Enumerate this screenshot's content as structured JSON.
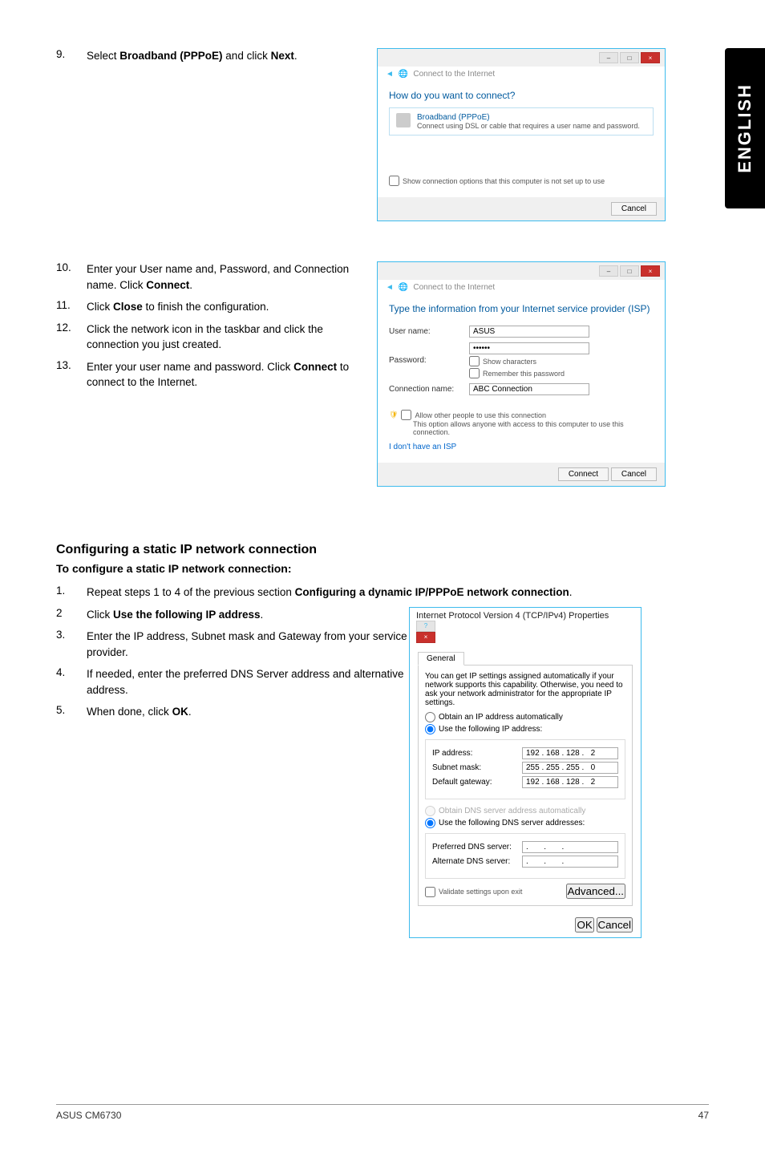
{
  "sideTab": "ENGLISH",
  "step9": {
    "num": "9.",
    "text_a": "Select ",
    "bold_a": "Broadband (PPPoE)",
    "text_b": " and click ",
    "bold_b": "Next",
    "text_c": "."
  },
  "dialog1": {
    "breadcrumb": "Connect to the Internet",
    "heading": "How do you want to connect?",
    "opt_title": "Broadband (PPPoE)",
    "opt_sub": "Connect using DSL or cable that requires a user name and password.",
    "show_opts": "Show connection options that this computer is not set up to use",
    "cancel": "Cancel"
  },
  "step10": {
    "num": "10.",
    "text_a": "Enter your User name and, Password, and Connection name. Click ",
    "bold": "Connect",
    "text_b": "."
  },
  "step11": {
    "num": "11.",
    "text_a": "Click ",
    "bold": "Close",
    "text_b": " to finish the configuration."
  },
  "step12": {
    "num": "12.",
    "text": "Click the network icon in the taskbar and click the connection you just created."
  },
  "step13": {
    "num": "13.",
    "text_a": "Enter your user name and password. Click ",
    "bold": "Connect",
    "text_b": " to connect to the Internet."
  },
  "dialog2": {
    "breadcrumb": "Connect to the Internet",
    "heading": "Type the information from your Internet service provider (ISP)",
    "user_label": "User name:",
    "user_val": "ASUS",
    "pass_label": "Password:",
    "pass_val": "••••••",
    "show_chars": "Show characters",
    "remember": "Remember this password",
    "conn_label": "Connection name:",
    "conn_val": "ABC Connection",
    "allow": "Allow other people to use this connection",
    "allow_sub": "This option allows anyone with access to this computer to use this connection.",
    "noisp": "I don't have an ISP",
    "connect": "Connect",
    "cancel": "Cancel"
  },
  "staticHead": "Configuring a static IP network connection",
  "staticSub": "To configure a static IP network connection:",
  "sstep1": {
    "num": "1.",
    "text_a": "Repeat steps 1 to 4 of the previous section ",
    "bold": "Configuring a dynamic IP/PPPoE network connection",
    "text_b": "."
  },
  "sstep2": {
    "num": "2",
    "text_a": "Click ",
    "bold": "Use the following IP address",
    "text_b": "."
  },
  "sstep3": {
    "num": "3.",
    "text": "Enter the IP address, Subnet mask and Gateway from your service provider."
  },
  "sstep4": {
    "num": "4.",
    "text": "If needed, enter the preferred DNS Server address and alternative address."
  },
  "sstep5": {
    "num": "5.",
    "text_a": "When done, click ",
    "bold": "OK",
    "text_b": "."
  },
  "props": {
    "title": "Internet Protocol Version 4 (TCP/IPv4) Properties",
    "tab": "General",
    "desc": "You can get IP settings assigned automatically if your network supports this capability. Otherwise, you need to ask your network administrator for the appropriate IP settings.",
    "r1": "Obtain an IP address automatically",
    "r2": "Use the following IP address:",
    "ip_lbl": "IP address:",
    "ip_val": "192 . 168 . 128 .   2",
    "mask_lbl": "Subnet mask:",
    "mask_val": "255 . 255 . 255 .   0",
    "gw_lbl": "Default gateway:",
    "gw_val": "192 . 168 . 128 .   2",
    "r3": "Obtain DNS server address automatically",
    "r4": "Use the following DNS server addresses:",
    "pdns_lbl": "Preferred DNS server:",
    "pdns_val": ".       .       .",
    "adns_lbl": "Alternate DNS server:",
    "adns_val": ".       .       .",
    "validate": "Validate settings upon exit",
    "adv": "Advanced...",
    "ok": "OK",
    "cancel": "Cancel"
  },
  "footer": {
    "left": "ASUS CM6730",
    "right": "47"
  }
}
